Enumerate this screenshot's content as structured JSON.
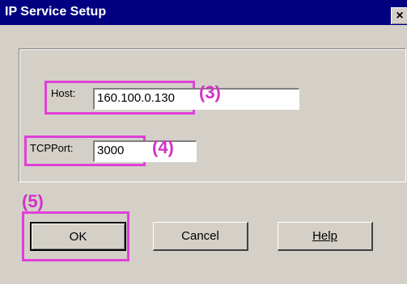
{
  "window": {
    "title": "IP Service Setup",
    "close_glyph": "×"
  },
  "form": {
    "host_label": "Host:",
    "host_value": "160.100.0.130",
    "port_label": "TCPPort:",
    "port_value": "3000"
  },
  "annotations": {
    "host": "(3)",
    "port": "(4)",
    "ok": "(5)",
    "color": "#e040d8"
  },
  "buttons": {
    "ok": "OK",
    "cancel": "Cancel",
    "help": "Help"
  }
}
